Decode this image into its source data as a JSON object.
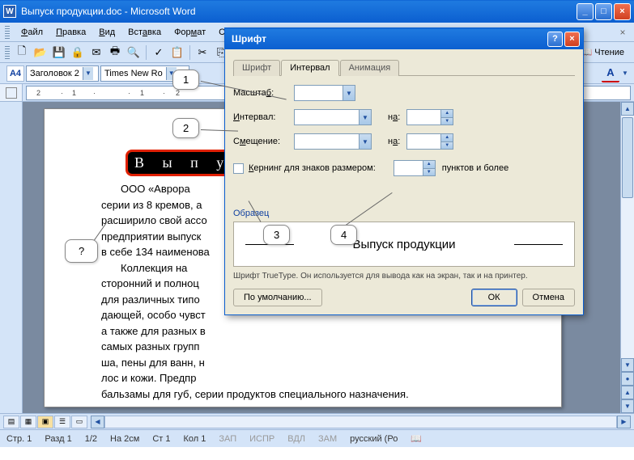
{
  "window": {
    "title": "Выпуск продукции.doc - Microsoft Word"
  },
  "menu": {
    "file": "Файл",
    "edit": "Правка",
    "view": "Вид",
    "insert": "Вставка",
    "format": "Формат",
    "more": "С",
    "help": "×"
  },
  "toolbar_reading": "Чтение",
  "format_toolbar": {
    "style_icon": "A4",
    "style": "Заголовок 2",
    "font": "Times New Ro"
  },
  "ruler_ticks": [
    "2",
    "1",
    "",
    "1",
    "2"
  ],
  "document": {
    "selected_title": "В ы п у с к",
    "body_line1": "ООО «Аврора",
    "body1": "серии из 8 кремов, а",
    "body2": "расширило свой ассо",
    "body3": "предприятии выпуск",
    "body4": "в себе 134 наименова",
    "body_para2a": "Коллекция на",
    "body_para2b": "сторонний и полноц",
    "body_para2c": "для различных типо",
    "body_para2d": "дающей, особо чувст",
    "body_para2e": "а также для разных в",
    "body_para2f": "самых разных групп",
    "body_para2g": "ша, пены для ванн, н",
    "body_para2h": "лос и кожи. Предпр",
    "body_last": "бальзамы для губ, серии продуктов специального назначения."
  },
  "dialog": {
    "title": "Шрифт",
    "tabs": {
      "font": "Шрифт",
      "spacing": "Интервал",
      "anim": "Анимация"
    },
    "scale_label": "Масштаб:",
    "spacing_label": "Интервал:",
    "position_label": "Смещение:",
    "by_label": "на:",
    "kerning_label": "Кернинг для знаков размером:",
    "kerning_suffix": "пунктов и более",
    "sample_label": "Образец",
    "sample_text": "Выпуск продукции",
    "hint": "Шрифт TrueType. Он используется для вывода как на экран, так и на принтер.",
    "default_btn": "По умолчанию...",
    "ok_btn": "ОК",
    "cancel_btn": "Отмена"
  },
  "callouts": {
    "c1": "1",
    "c2": "2",
    "c3": "3",
    "c4": "4",
    "cq": "?"
  },
  "status": {
    "page": "Стр. 1",
    "section": "Разд 1",
    "pages": "1/2",
    "at": "На 2см",
    "line": "Ст 1",
    "col": "Кол 1",
    "rec": "ЗАП",
    "trk": "ИСПР",
    "ext": "ВДЛ",
    "ovr": "ЗАМ",
    "lang": "русский (Ро"
  }
}
